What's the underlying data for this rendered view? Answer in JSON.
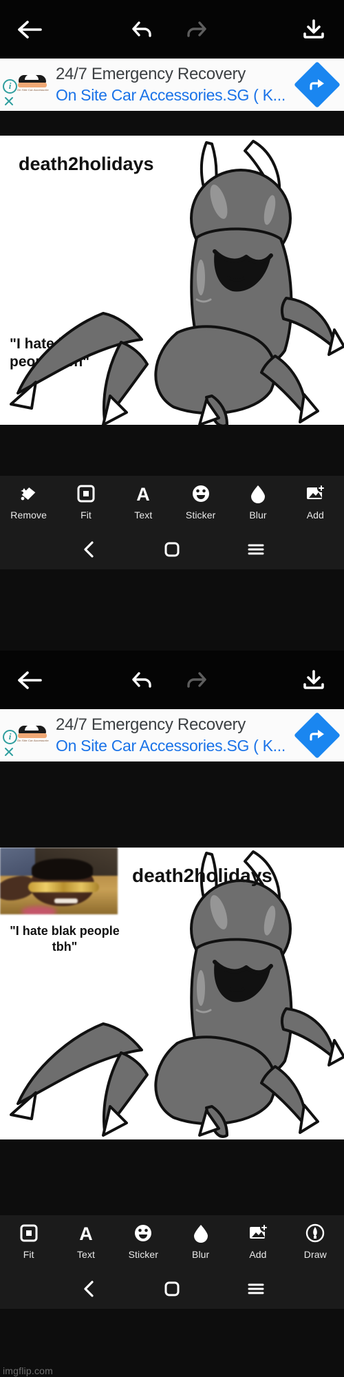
{
  "meta": {
    "watermark": "imgflip.com"
  },
  "appbar": {
    "back": "back-arrow",
    "undo": "undo-arrow",
    "redo": "redo-arrow",
    "download": "download-icon"
  },
  "ad": {
    "title": "24/7 Emergency Recovery",
    "subtitle": "On Site Car Accessories.SG ( K...",
    "info_glyph": "i",
    "close_glyph": "✕",
    "logo_text": "On Site Car Accessories.SG",
    "cta_icon": "directions-arrow-icon",
    "cta_color": "#1a86f0",
    "link_color": "#1a73e8",
    "title_color": "#3c4043"
  },
  "panel1": {
    "username": "death2holidays",
    "caption": "\"I hate blak\npeople tbh\"",
    "toolbar": [
      {
        "label": "Remove",
        "icon": "magic-eraser-icon"
      },
      {
        "label": "Fit",
        "icon": "fit-square-icon"
      },
      {
        "label": "Text",
        "icon": "text-a-icon"
      },
      {
        "label": "Sticker",
        "icon": "smiley-sticker-icon"
      },
      {
        "label": "Blur",
        "icon": "blur-droplet-icon"
      },
      {
        "label": "Add",
        "icon": "add-image-icon"
      }
    ]
  },
  "panel2": {
    "username": "death2holidays",
    "caption": "\"I hate blak people\ntbh\"",
    "toolbar": [
      {
        "label": "Fit",
        "icon": "fit-square-icon"
      },
      {
        "label": "Text",
        "icon": "text-a-icon"
      },
      {
        "label": "Sticker",
        "icon": "smiley-sticker-icon"
      },
      {
        "label": "Blur",
        "icon": "blur-droplet-icon"
      },
      {
        "label": "Add",
        "icon": "add-image-icon"
      },
      {
        "label": "Draw",
        "icon": "draw-pen-icon"
      }
    ]
  },
  "navbar": {
    "back": "nav-back-icon",
    "home": "nav-home-icon",
    "recents": "nav-menu-icon"
  }
}
